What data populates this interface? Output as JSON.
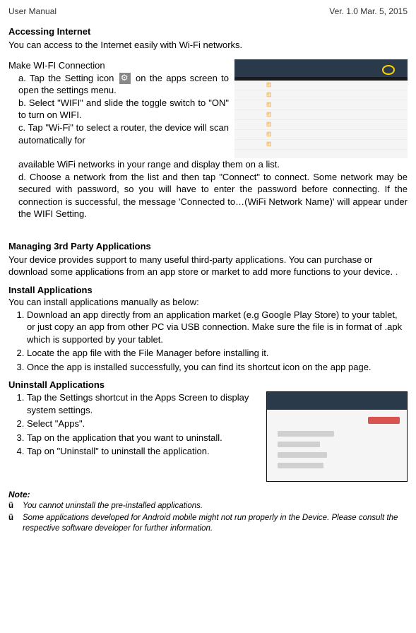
{
  "header": {
    "left": "User Manual",
    "right": "Ver. 1.0    Mar. 5, 2015"
  },
  "accessingInternet": {
    "title": "Accessing Internet",
    "intro": "You can access to the Internet easily with Wi-Fi networks.",
    "wifiTitle": "Make WI-FI Connection",
    "a1": "a. Tap the Setting icon ",
    "a2": " on the apps screen to open the settings menu.",
    "b": "b. Select \"WIFI\" and slide the toggle switch to \"ON\" to turn on WIFI.",
    "c1": "c. Tap \"Wi-Fi\" to select a router, the device will scan automatically for",
    "c2": "available WiFi networks in your range and display them on a list.",
    "d": "d. Choose a network from the list and then tap \"Connect\" to connect. Some network may be secured with password, so you will have to enter the password before connecting. If the connection is successful, the message 'Connected to…(WiFi Network Name)' will appear under the WIFI Setting."
  },
  "thirdParty": {
    "title": "Managing 3rd Party Applications",
    "intro1": "Your device provides support to many useful third-party applications. You can purchase or download some applications from an app store or market to add more functions to your device. ",
    "introDot": "."
  },
  "install": {
    "title": "Install Applications",
    "intro": "You can install applications manually as below:",
    "items": [
      "Download an app directly from an application market (e.g Google Play Store) to your tablet, or just copy an app from other PC via USB connection. Make sure the file is in format of .apk which is supported by your tablet.",
      "Locate the app file with the File Manager before installing it.",
      "Once the app is installed successfully, you can find its shortcut icon on the app page."
    ]
  },
  "uninstall": {
    "title": "Uninstall Applications",
    "items": [
      "Tap the Settings shortcut in the Apps Screen to display system settings.",
      "Select \"Apps\".",
      "Tap on the application that you want to uninstall.",
      "Tap on \"Uninstall\" to uninstall the application."
    ]
  },
  "note": {
    "title": "Note:",
    "bullet": "ü",
    "items": [
      "You cannot uninstall the pre-installed applications.",
      "Some applications developed for Android mobile might not run properly in the Device. Please consult the respective software developer for further information."
    ]
  }
}
